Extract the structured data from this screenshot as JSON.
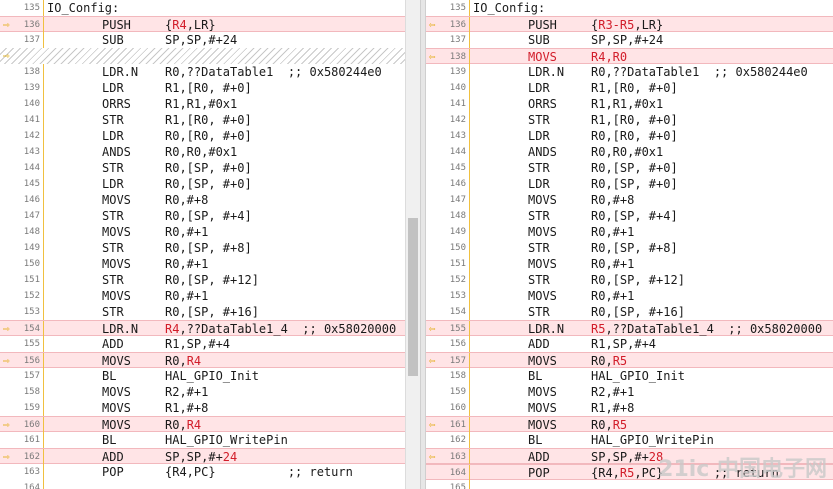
{
  "left": {
    "label": "IO_Config:",
    "label_line": "135",
    "rows": [
      {
        "n": "136",
        "op": "PUSH",
        "arg": "{R4,LR}",
        "hl": true,
        "arrow": true,
        "segs": [
          [
            "{",
            ""
          ],
          [
            "R4",
            "red"
          ],
          [
            ",LR}",
            ""
          ]
        ]
      },
      {
        "n": "137",
        "op": "SUB",
        "arg": "SP,SP,#+24"
      },
      {
        "hatch": true,
        "arrow": true
      },
      {
        "n": "138",
        "op": "LDR.N",
        "arg": "R0,??DataTable1  ;; 0x580244e0"
      },
      {
        "n": "139",
        "op": "LDR",
        "arg": "R1,[R0, #+0]"
      },
      {
        "n": "140",
        "op": "ORRS",
        "arg": "R1,R1,#0x1"
      },
      {
        "n": "141",
        "op": "STR",
        "arg": "R1,[R0, #+0]"
      },
      {
        "n": "142",
        "op": "LDR",
        "arg": "R0,[R0, #+0]"
      },
      {
        "n": "143",
        "op": "ANDS",
        "arg": "R0,R0,#0x1"
      },
      {
        "n": "144",
        "op": "STR",
        "arg": "R0,[SP, #+0]"
      },
      {
        "n": "145",
        "op": "LDR",
        "arg": "R0,[SP, #+0]"
      },
      {
        "n": "146",
        "op": "MOVS",
        "arg": "R0,#+8"
      },
      {
        "n": "147",
        "op": "STR",
        "arg": "R0,[SP, #+4]"
      },
      {
        "n": "148",
        "op": "MOVS",
        "arg": "R0,#+1"
      },
      {
        "n": "149",
        "op": "STR",
        "arg": "R0,[SP, #+8]"
      },
      {
        "n": "150",
        "op": "MOVS",
        "arg": "R0,#+1"
      },
      {
        "n": "151",
        "op": "STR",
        "arg": "R0,[SP, #+12]"
      },
      {
        "n": "152",
        "op": "MOVS",
        "arg": "R0,#+1"
      },
      {
        "n": "153",
        "op": "STR",
        "arg": "R0,[SP, #+16]"
      },
      {
        "n": "154",
        "op": "LDR.N",
        "arg": "R4,??DataTable1_4  ;; 0x58020000",
        "hl": true,
        "arrow": true,
        "segs": [
          [
            "R4",
            "red"
          ],
          [
            ",??DataTable1_4  ;; 0x58020000",
            ""
          ]
        ]
      },
      {
        "n": "155",
        "op": "ADD",
        "arg": "R1,SP,#+4"
      },
      {
        "n": "156",
        "op": "MOVS",
        "arg": "R0,R4",
        "hl": true,
        "arrow": true,
        "segs": [
          [
            "R0,",
            ""
          ],
          [
            "R4",
            "red"
          ]
        ]
      },
      {
        "n": "157",
        "op": "BL",
        "arg": "HAL_GPIO_Init"
      },
      {
        "n": "158",
        "op": "MOVS",
        "arg": "R2,#+1"
      },
      {
        "n": "159",
        "op": "MOVS",
        "arg": "R1,#+8"
      },
      {
        "n": "160",
        "op": "MOVS",
        "arg": "R0,R4",
        "hl": true,
        "arrow": true,
        "segs": [
          [
            "R0,",
            ""
          ],
          [
            "R4",
            "red"
          ]
        ]
      },
      {
        "n": "161",
        "op": "BL",
        "arg": "HAL_GPIO_WritePin"
      },
      {
        "n": "162",
        "op": "ADD",
        "arg": "SP,SP,#+24",
        "hl": true,
        "arrow": true,
        "segs": [
          [
            "SP,SP,#+",
            ""
          ],
          [
            "24",
            "red"
          ]
        ]
      },
      {
        "n": "163",
        "op": "POP",
        "arg": "{R4,PC}          ;; return"
      },
      {
        "n": "164",
        "op": "",
        "arg": ""
      }
    ]
  },
  "right": {
    "label": "IO_Config:",
    "label_line": "135",
    "rows": [
      {
        "n": "136",
        "op": "PUSH",
        "arg": "{R3-R5,LR}",
        "hl": true,
        "arrow": true,
        "segs": [
          [
            "{",
            ""
          ],
          [
            "R3-R5",
            "red"
          ],
          [
            ",LR}",
            ""
          ]
        ]
      },
      {
        "n": "137",
        "op": "SUB",
        "arg": "SP,SP,#+24"
      },
      {
        "n": "138",
        "op": "MOVS",
        "arg": "R4,R0",
        "hl": true,
        "arrow": true,
        "redop": true,
        "segs": [
          [
            "R4,R0",
            "red"
          ]
        ]
      },
      {
        "n": "139",
        "op": "LDR.N",
        "arg": "R0,??DataTable1  ;; 0x580244e0"
      },
      {
        "n": "140",
        "op": "LDR",
        "arg": "R1,[R0, #+0]"
      },
      {
        "n": "141",
        "op": "ORRS",
        "arg": "R1,R1,#0x1"
      },
      {
        "n": "142",
        "op": "STR",
        "arg": "R1,[R0, #+0]"
      },
      {
        "n": "143",
        "op": "LDR",
        "arg": "R0,[R0, #+0]"
      },
      {
        "n": "144",
        "op": "ANDS",
        "arg": "R0,R0,#0x1"
      },
      {
        "n": "145",
        "op": "STR",
        "arg": "R0,[SP, #+0]"
      },
      {
        "n": "146",
        "op": "LDR",
        "arg": "R0,[SP, #+0]"
      },
      {
        "n": "147",
        "op": "MOVS",
        "arg": "R0,#+8"
      },
      {
        "n": "148",
        "op": "STR",
        "arg": "R0,[SP, #+4]"
      },
      {
        "n": "149",
        "op": "MOVS",
        "arg": "R0,#+1"
      },
      {
        "n": "150",
        "op": "STR",
        "arg": "R0,[SP, #+8]"
      },
      {
        "n": "151",
        "op": "MOVS",
        "arg": "R0,#+1"
      },
      {
        "n": "152",
        "op": "STR",
        "arg": "R0,[SP, #+12]"
      },
      {
        "n": "153",
        "op": "MOVS",
        "arg": "R0,#+1"
      },
      {
        "n": "154",
        "op": "STR",
        "arg": "R0,[SP, #+16]"
      },
      {
        "n": "155",
        "op": "LDR.N",
        "arg": "R5,??DataTable1_4  ;; 0x58020000",
        "hl": true,
        "arrow": true,
        "segs": [
          [
            "R5",
            "red"
          ],
          [
            ",??DataTable1_4  ;; 0x58020000",
            ""
          ]
        ]
      },
      {
        "n": "156",
        "op": "ADD",
        "arg": "R1,SP,#+4"
      },
      {
        "n": "157",
        "op": "MOVS",
        "arg": "R0,R5",
        "hl": true,
        "arrow": true,
        "segs": [
          [
            "R0,",
            ""
          ],
          [
            "R5",
            "red"
          ]
        ]
      },
      {
        "n": "158",
        "op": "BL",
        "arg": "HAL_GPIO_Init"
      },
      {
        "n": "159",
        "op": "MOVS",
        "arg": "R2,#+1"
      },
      {
        "n": "160",
        "op": "MOVS",
        "arg": "R1,#+8"
      },
      {
        "n": "161",
        "op": "MOVS",
        "arg": "R0,R5",
        "hl": true,
        "arrow": true,
        "segs": [
          [
            "R0,",
            ""
          ],
          [
            "R5",
            "red"
          ]
        ]
      },
      {
        "n": "162",
        "op": "BL",
        "arg": "HAL_GPIO_WritePin"
      },
      {
        "n": "163",
        "op": "ADD",
        "arg": "SP,SP,#+28",
        "hl": true,
        "arrow": true,
        "segs": [
          [
            "SP,SP,#+",
            ""
          ],
          [
            "28",
            "red"
          ]
        ]
      },
      {
        "n": "164",
        "op": "POP",
        "arg": "{R4,R5,PC}       ;; return",
        "hl": true,
        "segs": [
          [
            "{R4,",
            ""
          ],
          [
            "R5",
            "red"
          ],
          [
            ",PC}       ;; return",
            ""
          ]
        ]
      },
      {
        "n": "165",
        "op": "",
        "arg": ""
      }
    ]
  },
  "colors": {
    "highlight": "#ffe4e6",
    "diff_text": "#d21d2a",
    "arrow": "#e0a800"
  },
  "icons": {
    "diff_marker": "arrow-right-icon",
    "diff_marker_right": "arrow-left-icon"
  },
  "watermark": "21ic 中国电子网"
}
